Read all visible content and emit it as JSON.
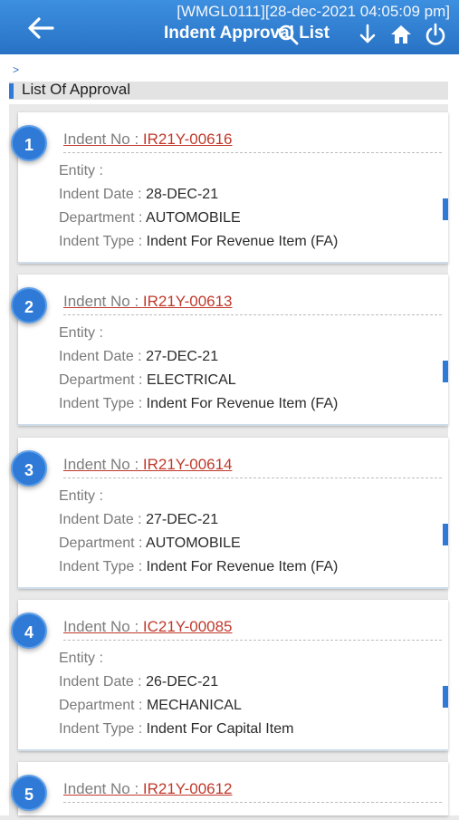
{
  "header": {
    "meta": "[WMGL0111][28-dec-2021 04:05:09 pm]",
    "title": "Indent Approval List"
  },
  "breadcrumb": ">",
  "list_title": "List Of Approval",
  "labels": {
    "indent_no": "Indent No : ",
    "entity": "Entity : ",
    "indent_date": "Indent Date : ",
    "department": "Department : ",
    "indent_type": "Indent Type : "
  },
  "items": [
    {
      "num": "1",
      "indent_no": "IR21Y-00616",
      "entity": "",
      "date": "28-DEC-21",
      "department": "AUTOMOBILE",
      "type": "Indent For Revenue Item (FA)"
    },
    {
      "num": "2",
      "indent_no": "IR21Y-00613",
      "entity": "",
      "date": "27-DEC-21",
      "department": "ELECTRICAL",
      "type": "Indent For Revenue Item (FA)"
    },
    {
      "num": "3",
      "indent_no": "IR21Y-00614",
      "entity": "",
      "date": "27-DEC-21",
      "department": "AUTOMOBILE",
      "type": "Indent For Revenue Item (FA)"
    },
    {
      "num": "4",
      "indent_no": "IC21Y-00085",
      "entity": "",
      "date": "26-DEC-21",
      "department": "MECHANICAL",
      "type": "Indent For Capital Item"
    },
    {
      "num": "5",
      "indent_no": "IR21Y-00612",
      "entity": "",
      "date": "",
      "department": "",
      "type": ""
    }
  ]
}
